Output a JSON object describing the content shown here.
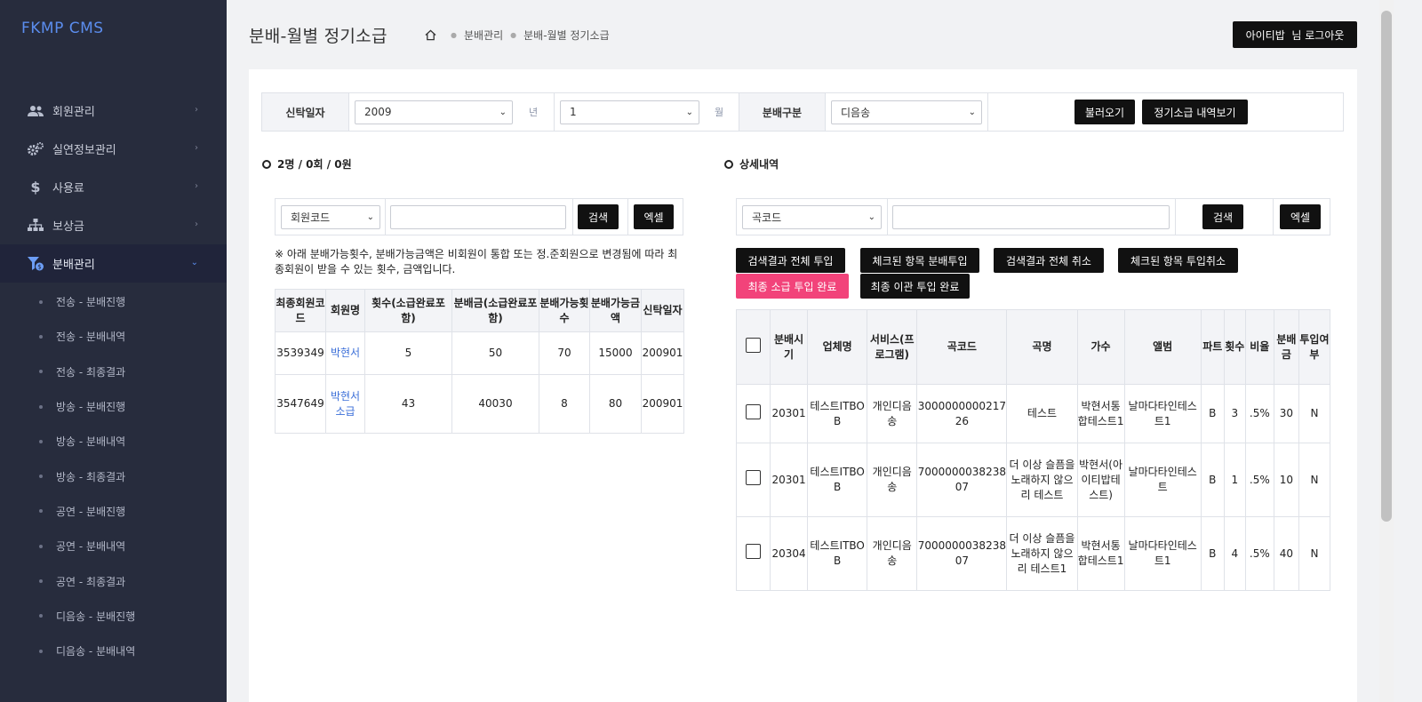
{
  "app": {
    "brand": "FKMP CMS"
  },
  "sidebar": {
    "items": [
      {
        "label": "회원관리",
        "icon": "users-icon"
      },
      {
        "label": "실연정보관리",
        "icon": "gears-icon"
      },
      {
        "label": "사용료",
        "icon": "dollar-icon"
      },
      {
        "label": "보상금",
        "icon": "sitemap-icon"
      },
      {
        "label": "분배관리",
        "icon": "funnel-dollar-icon",
        "active": true
      }
    ],
    "sub_items": [
      "전송 - 분배진행",
      "전송 - 분배내역",
      "전송 - 최종결과",
      "방송 - 분배진행",
      "방송 - 분배내역",
      "방송 - 최종결과",
      "공연 - 분배진행",
      "공연 - 분배내역",
      "공연 - 최종결과",
      "디음송 - 분배진행",
      "디음송 - 분배내역"
    ]
  },
  "header": {
    "title": "분배-월별 정기소급",
    "breadcrumb": [
      "분배관리",
      "분배-월별 정기소급"
    ],
    "user": "아이티밥",
    "logout_label": "님 로그아웃"
  },
  "filter": {
    "trust_date_label": "신탁일자",
    "year_value": "2009",
    "year_unit": "년",
    "month_value": "1",
    "month_unit": "월",
    "category_label": "분배구분",
    "category_value": "디음송",
    "load_button": "불러오기",
    "view_button": "정기소급 내역보기"
  },
  "left": {
    "summary": "2명 / 0회 / 0원",
    "search_select": "회원코드",
    "search_input": "",
    "search_button": "검색",
    "excel_button": "엑셀",
    "notice": "※ 아래 분배가능횟수, 분배가능금액은 비회원이 통합 또는 정.준회원으로 변경됨에 따라 최종회원이 받을 수 있는 횟수, 금액입니다.",
    "columns": [
      "최종회원코드",
      "회원명",
      "횟수(소급완료포함)",
      "분배금(소급완료포함)",
      "분배가능횟수",
      "분배가능금액",
      "신탁일자"
    ],
    "rows": [
      [
        "3539349",
        "박현서",
        "5",
        "50",
        "70",
        "15000",
        "200901"
      ],
      [
        "3547649",
        "박현서소급",
        "43",
        "40030",
        "8",
        "80",
        "200901"
      ]
    ]
  },
  "right": {
    "title": "상세내역",
    "search_select": "곡코드",
    "search_input": "",
    "search_button": "검색",
    "excel_button": "엑셀",
    "actions": [
      "검색결과 전체 투입",
      "체크된 항목 분배투입",
      "검색결과 전체 취소",
      "체크된 항목 투입취소"
    ],
    "actions2": [
      "최종 소급 투입 완료",
      "최종 이관 투입 완료"
    ],
    "columns": [
      "분배시기",
      "업체명",
      "서비스(프로그램)",
      "곡코드",
      "곡명",
      "가수",
      "앨범",
      "파트",
      "횟수",
      "비율",
      "분배금",
      "투입여부"
    ],
    "rows": [
      [
        "20301",
        "테스트ITBOB",
        "개인디음송",
        "300000000021726",
        "테스트",
        "박현서통합테스트1",
        "날마다타인테스트1",
        "B",
        "3",
        ".5%",
        "30",
        "N"
      ],
      [
        "20301",
        "테스트ITBOB",
        "개인디음송",
        "700000003823807",
        "더 이상 슬픔을 노래하지 않으리 테스트",
        "박현서(아이티밥테스트)",
        "날마다타인테스트",
        "B",
        "1",
        ".5%",
        "10",
        "N"
      ],
      [
        "20304",
        "테스트ITBOB",
        "개인디음송",
        "700000003823807",
        "더 이상 슬픔을 노래하지 않으리 테스트1",
        "박현서통합테스트1",
        "날마다타인테스트1",
        "B",
        "4",
        ".5%",
        "40",
        "N"
      ]
    ]
  }
}
